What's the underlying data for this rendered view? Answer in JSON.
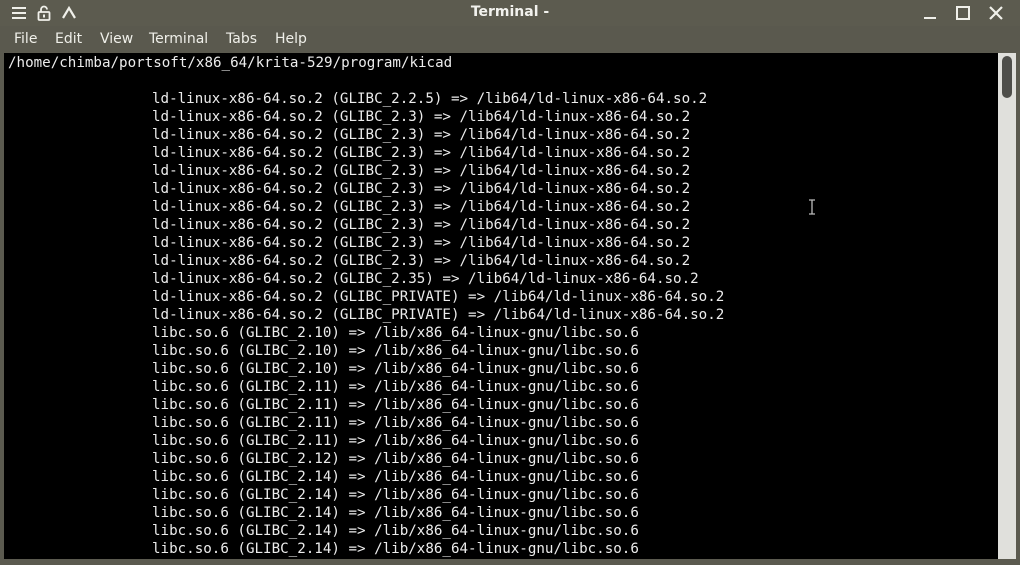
{
  "window": {
    "title": "Terminal -"
  },
  "titlebar_icons": {
    "left": [
      "hamburger-menu-icon",
      "unlock-icon",
      "chevron-up-icon"
    ],
    "right": [
      "minimize-icon",
      "maximize-icon",
      "close-icon"
    ]
  },
  "menu": {
    "file": "File",
    "edit": "Edit",
    "view": "View",
    "terminal": "Terminal",
    "tabs": "Tabs",
    "help": "Help"
  },
  "terminal": {
    "path_line": "/home/chimba/portsoft/x86_64/krita-529/program/kicad",
    "lines": [
      "ld-linux-x86-64.so.2 (GLIBC_2.2.5) => /lib64/ld-linux-x86-64.so.2",
      "ld-linux-x86-64.so.2 (GLIBC_2.3) => /lib64/ld-linux-x86-64.so.2",
      "ld-linux-x86-64.so.2 (GLIBC_2.3) => /lib64/ld-linux-x86-64.so.2",
      "ld-linux-x86-64.so.2 (GLIBC_2.3) => /lib64/ld-linux-x86-64.so.2",
      "ld-linux-x86-64.so.2 (GLIBC_2.3) => /lib64/ld-linux-x86-64.so.2",
      "ld-linux-x86-64.so.2 (GLIBC_2.3) => /lib64/ld-linux-x86-64.so.2",
      "ld-linux-x86-64.so.2 (GLIBC_2.3) => /lib64/ld-linux-x86-64.so.2",
      "ld-linux-x86-64.so.2 (GLIBC_2.3) => /lib64/ld-linux-x86-64.so.2",
      "ld-linux-x86-64.so.2 (GLIBC_2.3) => /lib64/ld-linux-x86-64.so.2",
      "ld-linux-x86-64.so.2 (GLIBC_2.3) => /lib64/ld-linux-x86-64.so.2",
      "ld-linux-x86-64.so.2 (GLIBC_2.35) => /lib64/ld-linux-x86-64.so.2",
      "ld-linux-x86-64.so.2 (GLIBC_PRIVATE) => /lib64/ld-linux-x86-64.so.2",
      "ld-linux-x86-64.so.2 (GLIBC_PRIVATE) => /lib64/ld-linux-x86-64.so.2",
      "libc.so.6 (GLIBC_2.10) => /lib/x86_64-linux-gnu/libc.so.6",
      "libc.so.6 (GLIBC_2.10) => /lib/x86_64-linux-gnu/libc.so.6",
      "libc.so.6 (GLIBC_2.10) => /lib/x86_64-linux-gnu/libc.so.6",
      "libc.so.6 (GLIBC_2.11) => /lib/x86_64-linux-gnu/libc.so.6",
      "libc.so.6 (GLIBC_2.11) => /lib/x86_64-linux-gnu/libc.so.6",
      "libc.so.6 (GLIBC_2.11) => /lib/x86_64-linux-gnu/libc.so.6",
      "libc.so.6 (GLIBC_2.11) => /lib/x86_64-linux-gnu/libc.so.6",
      "libc.so.6 (GLIBC_2.12) => /lib/x86_64-linux-gnu/libc.so.6",
      "libc.so.6 (GLIBC_2.14) => /lib/x86_64-linux-gnu/libc.so.6",
      "libc.so.6 (GLIBC_2.14) => /lib/x86_64-linux-gnu/libc.so.6",
      "libc.so.6 (GLIBC_2.14) => /lib/x86_64-linux-gnu/libc.so.6",
      "libc.so.6 (GLIBC_2.14) => /lib/x86_64-linux-gnu/libc.so.6",
      "libc.so.6 (GLIBC_2.14) => /lib/x86_64-linux-gnu/libc.so.6"
    ]
  },
  "colors": {
    "titlebar_bg": "#5c5b4f",
    "terminal_bg": "#000000",
    "terminal_fg": "#ececec",
    "scrollbar_bg": "#e0e0dc",
    "scroll_thumb": "#4e4e4a"
  }
}
